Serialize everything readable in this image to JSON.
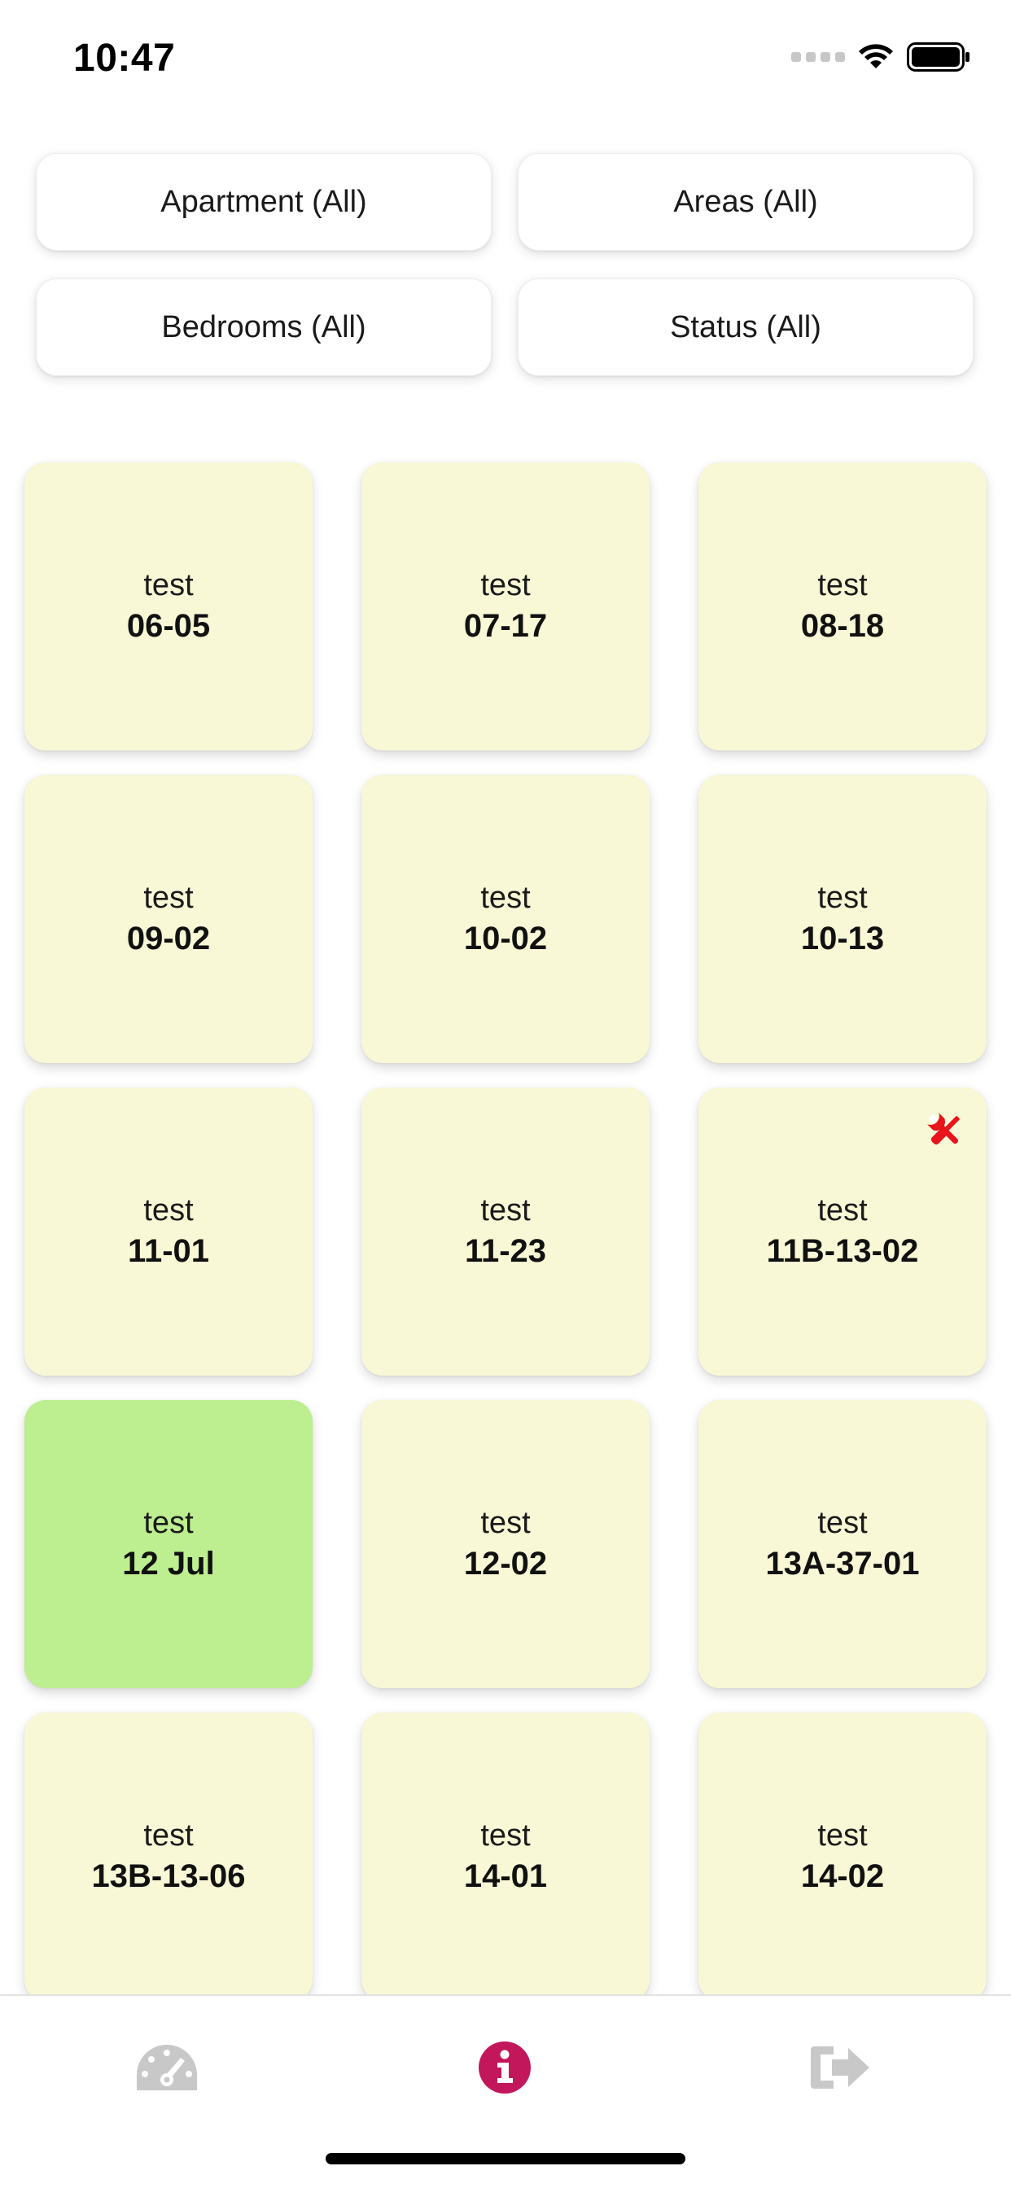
{
  "status_bar": {
    "time": "10:47"
  },
  "filters": [
    {
      "label": "Apartment (All)"
    },
    {
      "label": "Areas (All)"
    },
    {
      "label": "Bedrooms (All)"
    },
    {
      "label": "Status (All)"
    }
  ],
  "tiles": [
    {
      "label": "test",
      "code": "06-05"
    },
    {
      "label": "test",
      "code": "07-17"
    },
    {
      "label": "test",
      "code": "08-18"
    },
    {
      "label": "test",
      "code": "09-02"
    },
    {
      "label": "test",
      "code": "10-02"
    },
    {
      "label": "test",
      "code": "10-13"
    },
    {
      "label": "test",
      "code": "11-01"
    },
    {
      "label": "test",
      "code": "11-23"
    },
    {
      "label": "test",
      "code": "11B-13-02",
      "badge": "tools-icon"
    },
    {
      "label": "test",
      "code": "12 Jul",
      "status": "green"
    },
    {
      "label": "test",
      "code": "12-02"
    },
    {
      "label": "test",
      "code": "13A-37-01"
    },
    {
      "label": "test",
      "code": "13B-13-06"
    },
    {
      "label": "test",
      "code": "14-01"
    },
    {
      "label": "test",
      "code": "14-02"
    }
  ],
  "tab_bar": {
    "items": [
      {
        "icon": "dashboard-gauge-icon",
        "active": false
      },
      {
        "icon": "info-icon",
        "active": true
      },
      {
        "icon": "logout-icon",
        "active": false
      }
    ]
  },
  "colors": {
    "tile_default": "#f8f8d6",
    "tile_green": "#bdee90",
    "badge_red": "#e8141b",
    "tab_active": "#c2185b",
    "tab_inactive": "#c8c8c8"
  }
}
